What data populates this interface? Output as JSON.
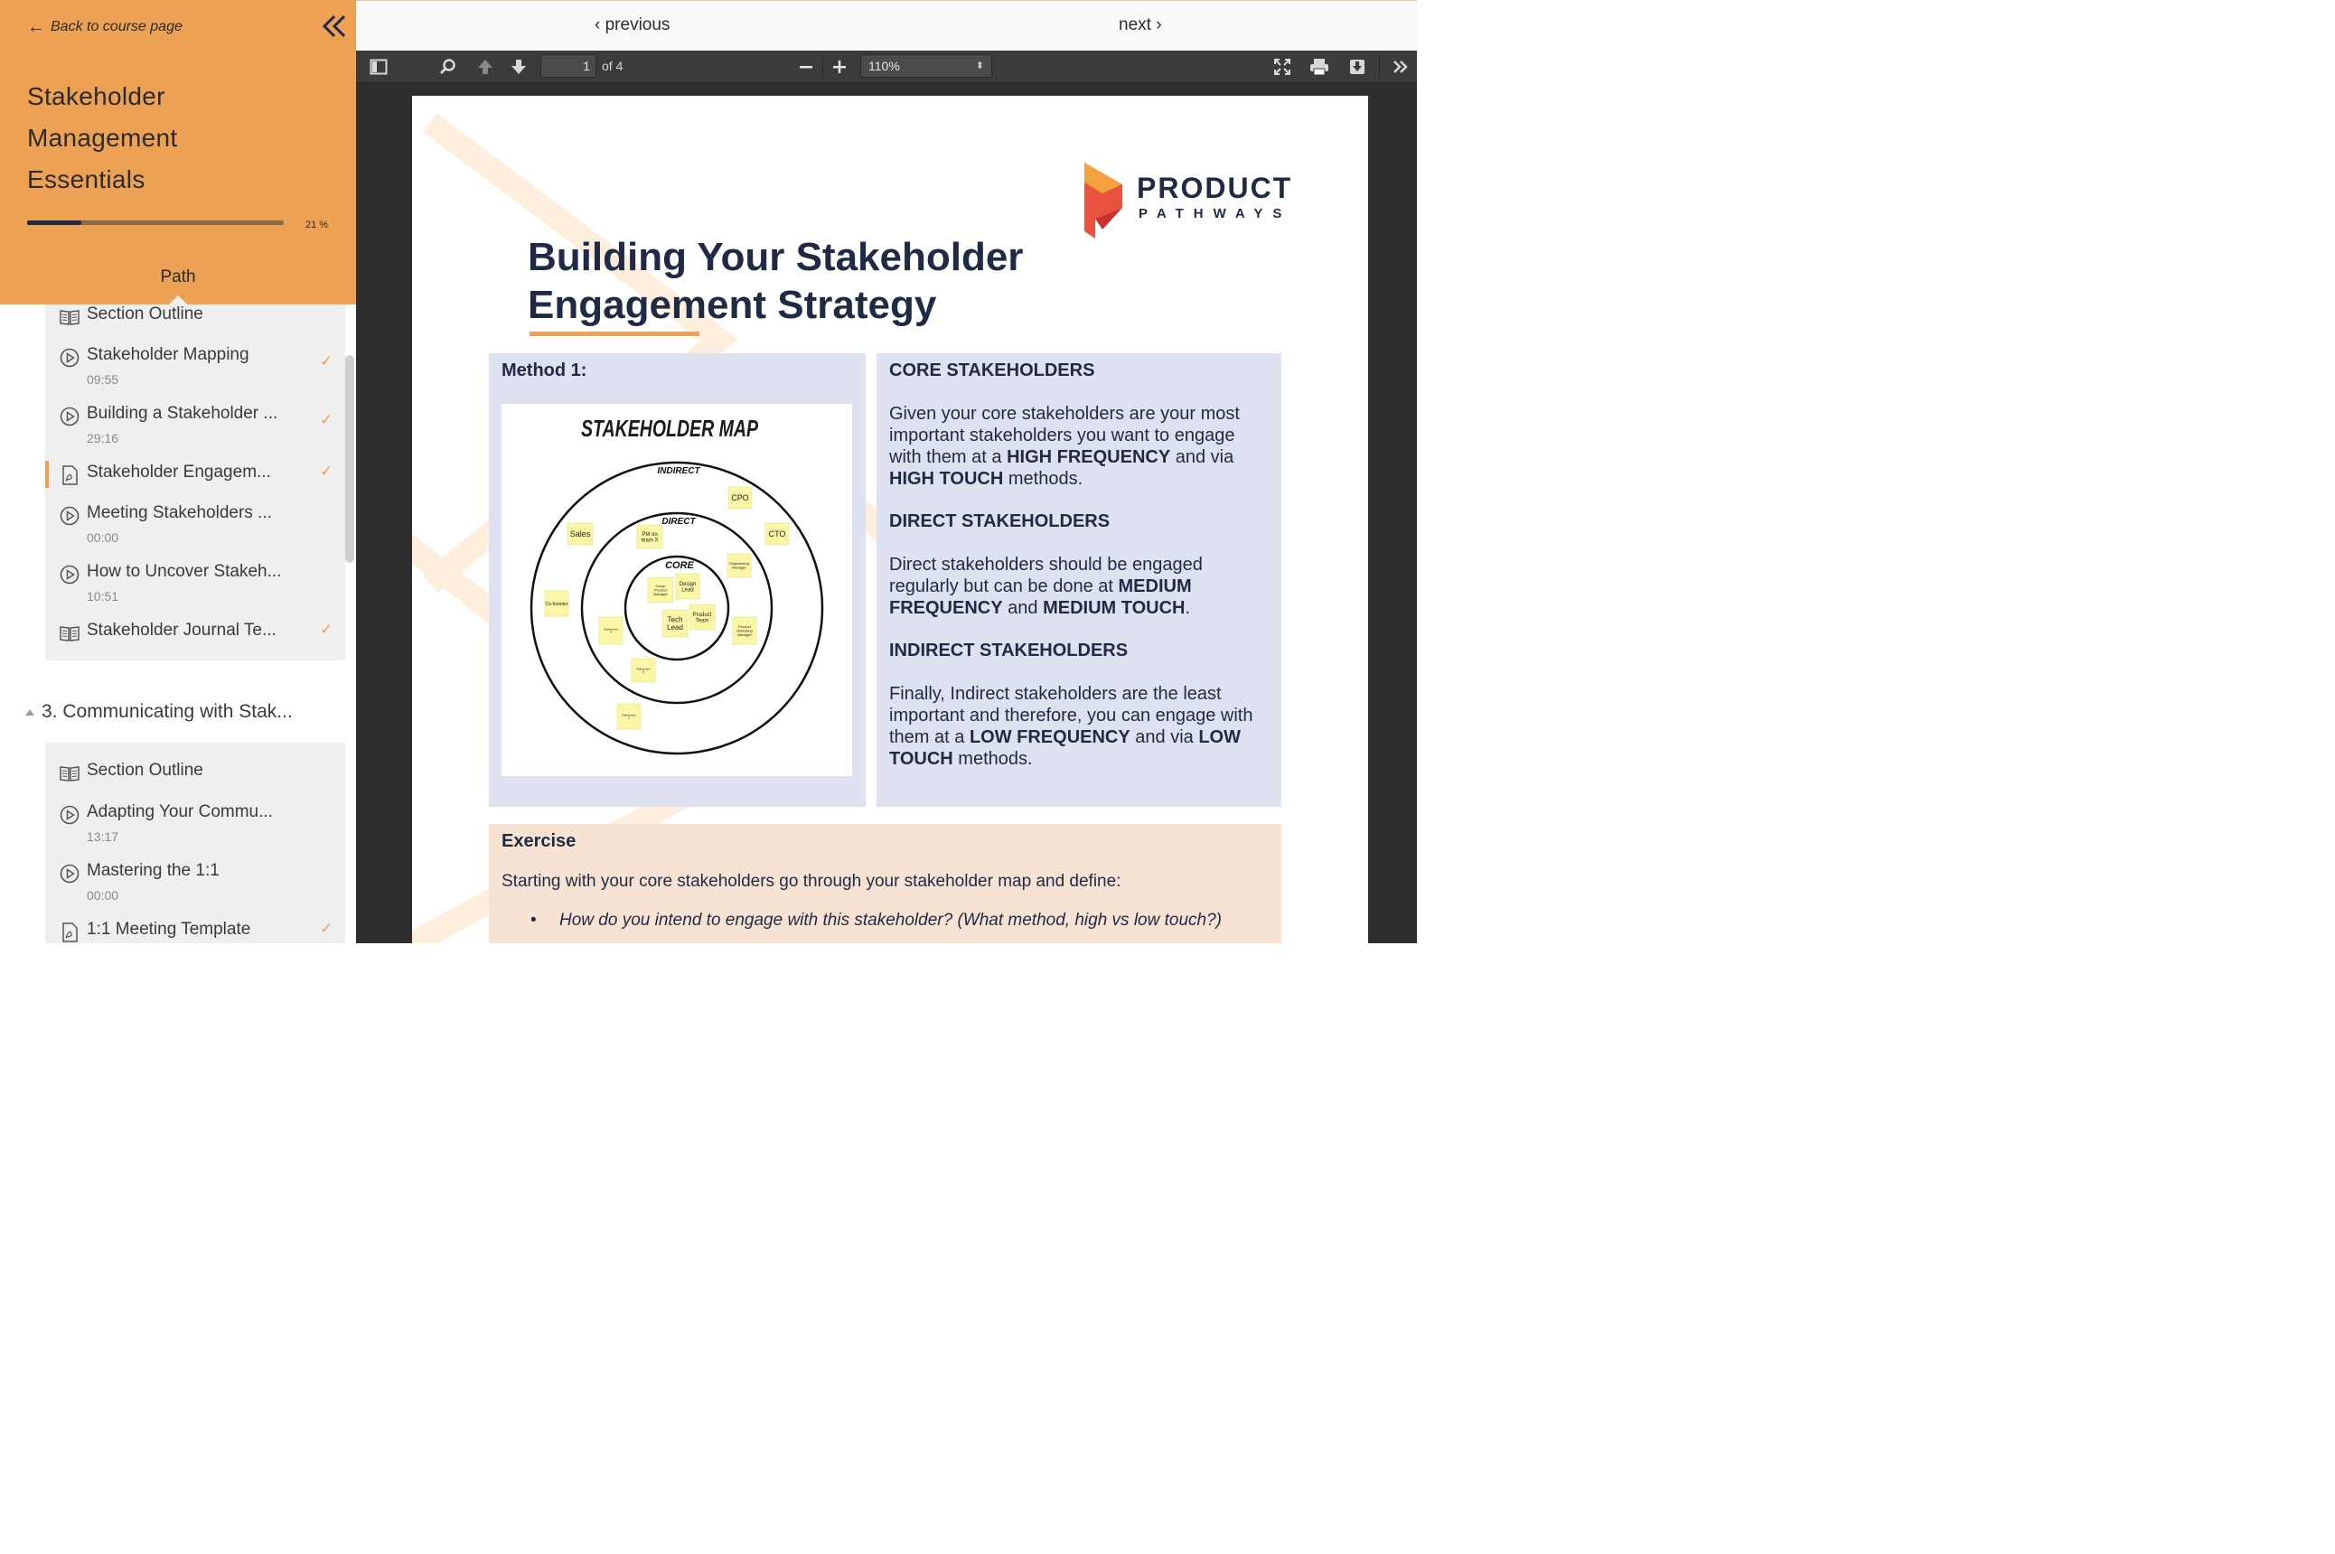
{
  "sidebar": {
    "back_label": "Back to course page",
    "course_title": "Stakeholder Management Essentials",
    "progress_value": 21,
    "progress_label": "21 %",
    "tab_label": "Path",
    "lessons_a": [
      {
        "icon": "book-icon",
        "title": "Section Outline",
        "duration": "",
        "complete": false
      },
      {
        "icon": "play-icon",
        "title": "Stakeholder Mapping",
        "duration": "09:55",
        "complete": true
      },
      {
        "icon": "play-icon",
        "title": "Building a Stakeholder ...",
        "duration": "29:16",
        "complete": true
      },
      {
        "icon": "pdf-icon",
        "title": "Stakeholder Engagem...",
        "duration": "",
        "complete": true,
        "current": true
      },
      {
        "icon": "play-icon",
        "title": "Meeting Stakeholders ...",
        "duration": "00:00",
        "complete": false
      },
      {
        "icon": "play-icon",
        "title": "How to Uncover Stakeh...",
        "duration": "10:51",
        "complete": false
      },
      {
        "icon": "book-icon",
        "title": "Stakeholder Journal Te...",
        "duration": "",
        "complete": true
      }
    ],
    "section3_title": "3. Communicating with Stak...",
    "lessons_b": [
      {
        "icon": "book-icon",
        "title": "Section Outline",
        "duration": "",
        "complete": false
      },
      {
        "icon": "play-icon",
        "title": "Adapting Your Commu...",
        "duration": "13:17",
        "complete": false
      },
      {
        "icon": "play-icon",
        "title": "Mastering the 1:1",
        "duration": "00:00",
        "complete": false
      },
      {
        "icon": "pdf-icon",
        "title": "1:1 Meeting Template",
        "duration": "",
        "complete": true
      }
    ],
    "check_mark": "✓"
  },
  "nav": {
    "previous_label": "‹ previous",
    "next_label": "next ›"
  },
  "toolbar": {
    "page_value": "1",
    "page_of": "of 4",
    "zoom_value": "110%"
  },
  "pdf": {
    "brand_name": "PRODUCT",
    "brand_sub": "PATHWAYS",
    "title": "Building Your Stakeholder Engagement Strategy",
    "method_label": "Method 1:",
    "map": {
      "title": "STAKEHOLDER MAP",
      "ring_indirect": "INDIRECT",
      "ring_direct": "DIRECT",
      "ring_core": "CORE",
      "notes": {
        "cpo": "CPO",
        "cto": "CTO",
        "sales": "Sales",
        "pm": "PM on team X",
        "eng_mgr": "Engineering Manager",
        "cofounder": "Co-founder",
        "group_pm": "Group Product Manager",
        "design": "Design Lead",
        "tech": "Tech Lead",
        "product_team": "Product Team",
        "pmm": "Product Marketing Manager",
        "stake_a": "Stakeholder A",
        "stake_b": "Stakeholder B",
        "stake_c": "Stakeholder C"
      }
    },
    "core_heading": "CORE STAKEHOLDERS",
    "core_text_1": "Given your core stakeholders are your most important stakeholders you want to engage with them at a ",
    "core_bold_1": "HIGH FREQUENCY",
    "core_text_2": " and via ",
    "core_bold_2": "HIGH TOUCH",
    "core_text_3": " methods.",
    "direct_heading": "DIRECT STAKEHOLDERS",
    "direct_text_1": "Direct stakeholders should be engaged regularly but can be done at ",
    "direct_bold_1": "MEDIUM FREQUENCY",
    "direct_text_2": " and ",
    "direct_bold_2": "MEDIUM TOUCH",
    "direct_text_3": ".",
    "indirect_heading": "INDIRECT STAKEHOLDERS",
    "indirect_text_1": "Finally, Indirect stakeholders are the least important and therefore, you can engage with them at a ",
    "indirect_bold_1": "LOW FREQUENCY",
    "indirect_text_2": " and via ",
    "indirect_bold_2": "LOW TOUCH",
    "indirect_text_3": " methods.",
    "exercise_title": "Exercise",
    "exercise_intro": "Starting with your core stakeholders go through your stakeholder map and define:",
    "exercise_bullet": "How do you intend to engage with this stakeholder? (What method, high vs low touch?)"
  },
  "colors": {
    "accent": "#eca154",
    "navy": "#1f2a44",
    "panel_blue": "#dde1f0",
    "panel_peach": "#f7e2d4",
    "sticky": "#fbf6a6"
  }
}
